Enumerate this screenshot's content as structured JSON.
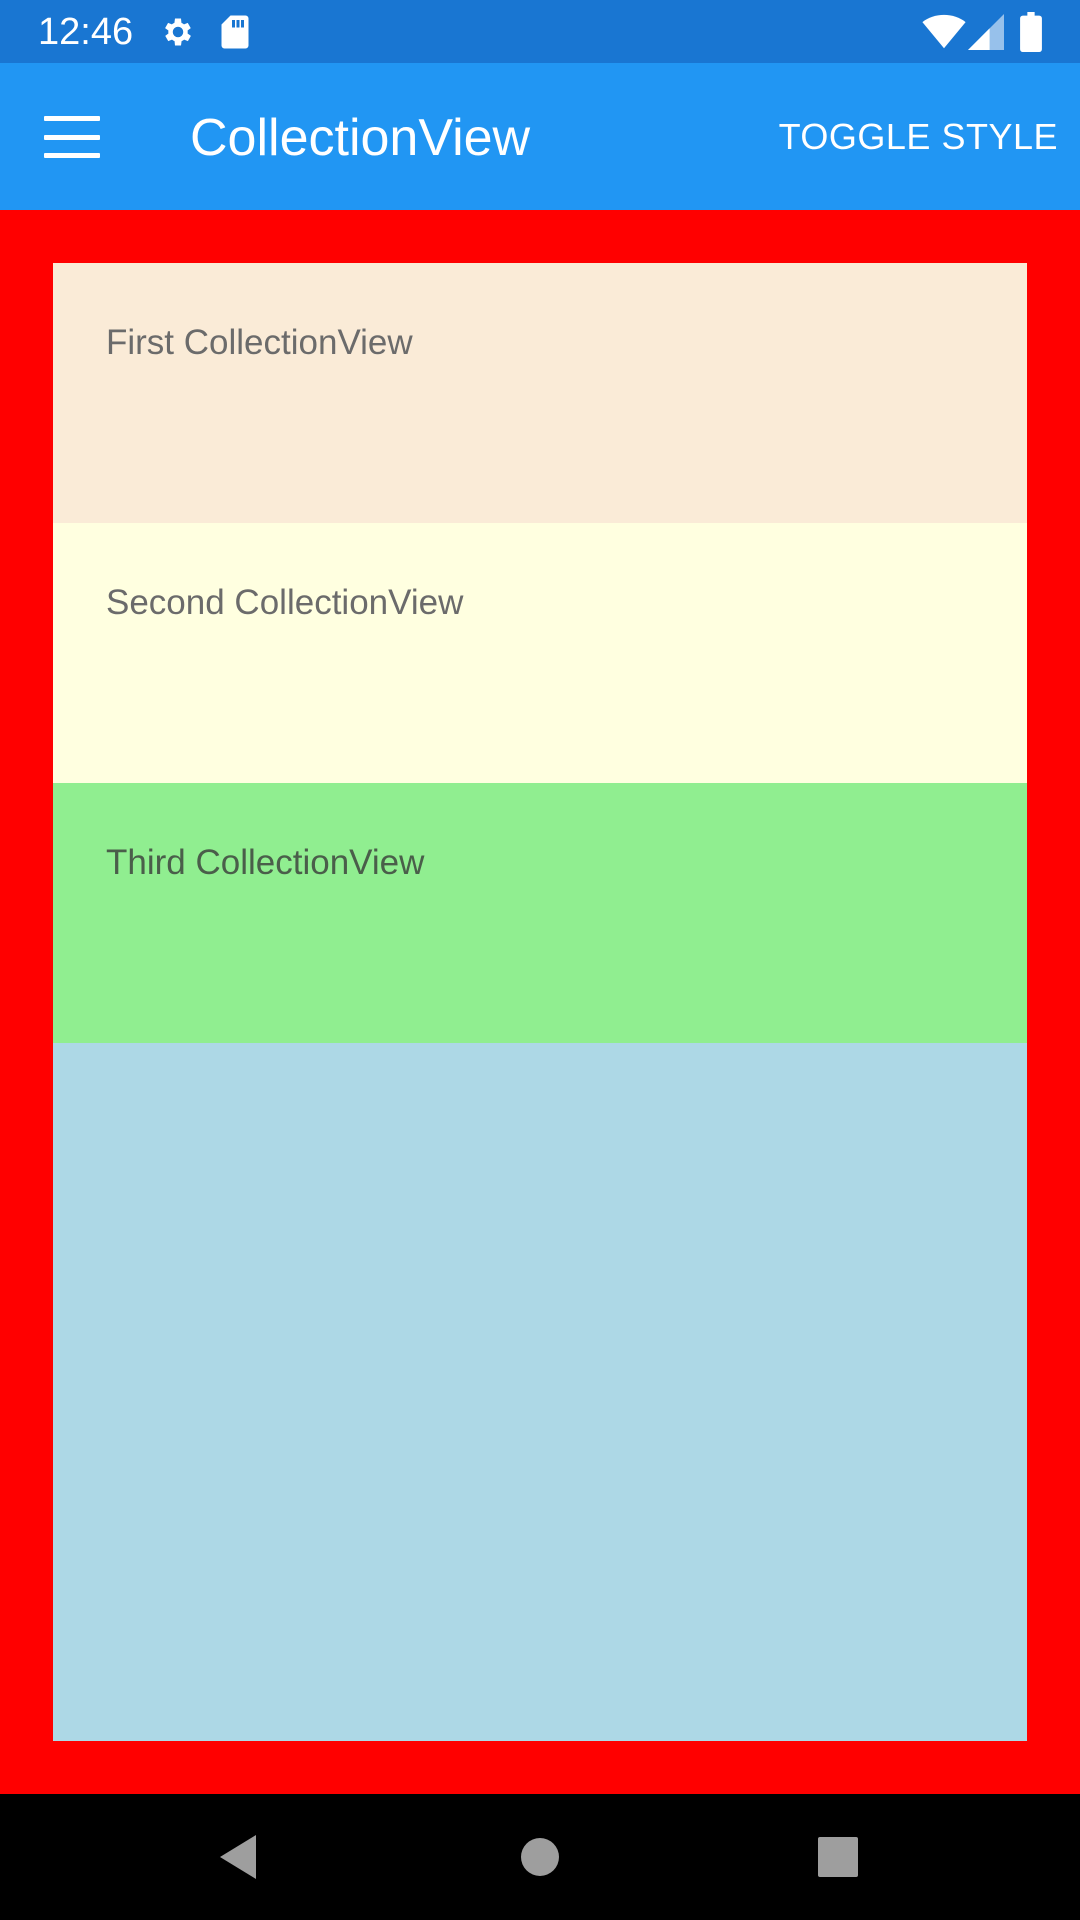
{
  "status_bar": {
    "time": "12:46",
    "icons": [
      "gear-icon",
      "sd-card-icon",
      "wifi-icon",
      "cell-signal-icon",
      "battery-icon"
    ]
  },
  "app_bar": {
    "menu_icon": "hamburger-icon",
    "title": "CollectionView",
    "toggle_label": "TOGGLE STYLE"
  },
  "colors": {
    "status_bar": "#1976D2",
    "app_bar": "#2196F3",
    "page_background": "#FF0000",
    "collection_background": "#ADD8E6",
    "nav_bar": "#000000"
  },
  "collections": [
    {
      "label": "First CollectionView",
      "color": "#FAEBD7"
    },
    {
      "label": "Second CollectionView",
      "color": "#FFFFE0"
    },
    {
      "label": "Third CollectionView",
      "color": "#90EE90"
    }
  ],
  "nav_bar": {
    "buttons": [
      "back-icon",
      "home-icon",
      "recents-icon"
    ]
  }
}
